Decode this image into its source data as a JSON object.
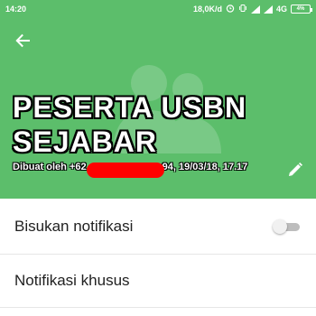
{
  "status_bar": {
    "time": "14:20",
    "network_speed": "18,0K/d",
    "network_type": "4G",
    "battery_percent": "4%"
  },
  "header": {
    "background_color": "#5cbe6b",
    "back_icon": "arrow-back-icon",
    "title": "PESERTA USBN SEJABAR",
    "created_prefix": "Dibuat oleh +62",
    "created_suffix": "94, 19/03/18, 17.17",
    "edit_icon": "pencil-icon"
  },
  "settings": {
    "mute_notifications": {
      "label": "Bisukan notifikasi",
      "enabled": false
    },
    "custom_notifications": {
      "label": "Notifikasi khusus"
    }
  }
}
